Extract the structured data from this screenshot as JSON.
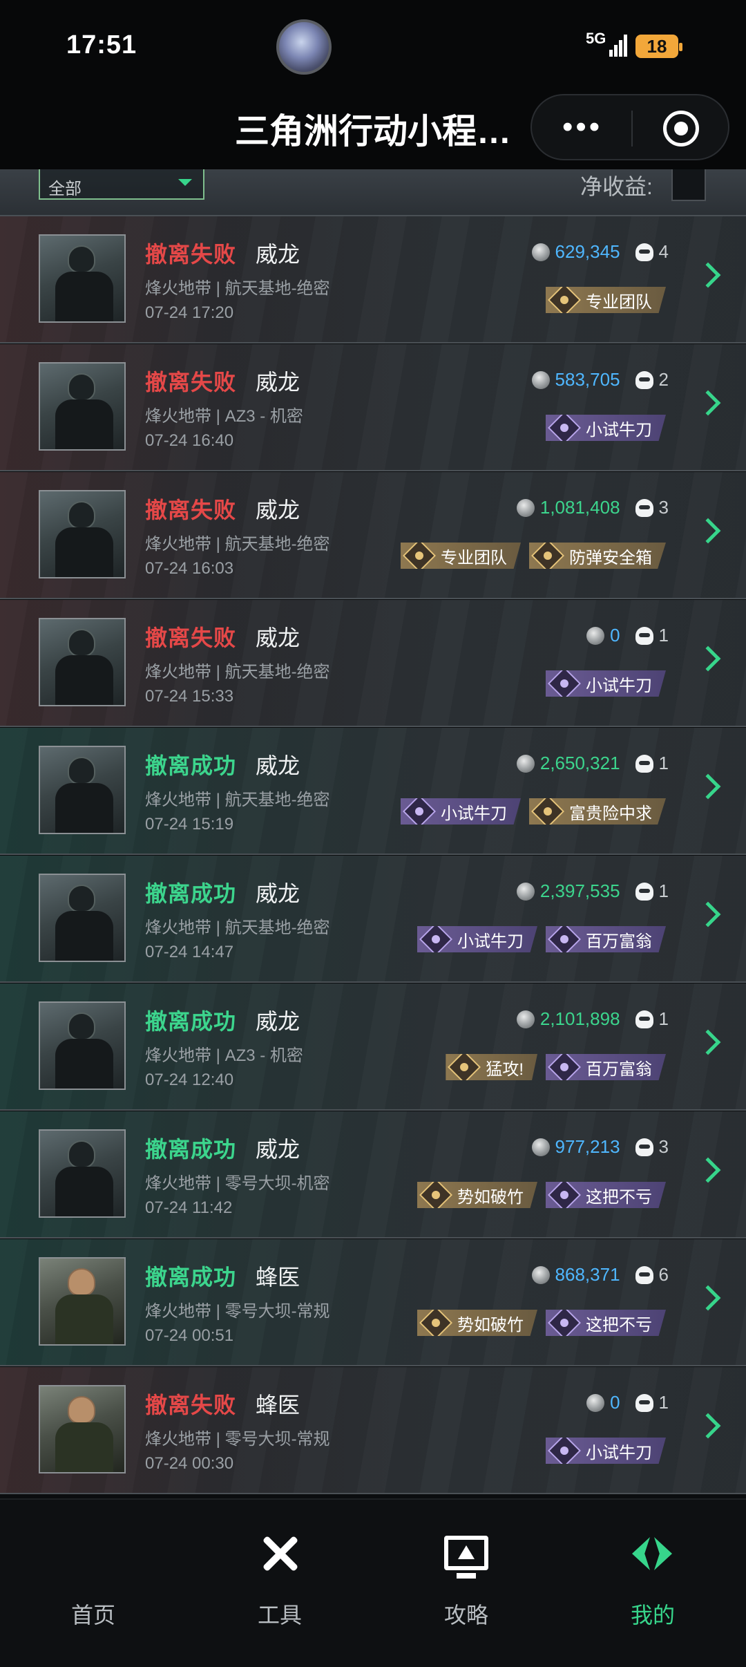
{
  "status_bar": {
    "time": "17:51",
    "network": "5G",
    "battery": "18"
  },
  "title_bar": {
    "title": "三角洲行动小程…",
    "more_glyph": "•••"
  },
  "filter": {
    "selected": "全部",
    "net_income_label": "净收益:"
  },
  "colors": {
    "fail": "#e54848",
    "success": "#3cd58d",
    "accent": "#37d58b",
    "value_blue": "#4fb7ff"
  },
  "rows": [
    {
      "status": "撤离失败",
      "result": "fail",
      "operator": "威龙",
      "avatar": "soldier",
      "map": "烽火地带 | 航天基地-绝密",
      "datetime": "07-24 17:20",
      "value": "629,345",
      "value_color": "blue",
      "kills": "4",
      "badges": [
        {
          "label": "专业团队",
          "tier": "gold"
        }
      ]
    },
    {
      "status": "撤离失败",
      "result": "fail",
      "operator": "威龙",
      "avatar": "soldier",
      "map": "烽火地带 | AZ3 - 机密",
      "datetime": "07-24 16:40",
      "value": "583,705",
      "value_color": "blue",
      "kills": "2",
      "badges": [
        {
          "label": "小试牛刀",
          "tier": "purple"
        }
      ]
    },
    {
      "status": "撤离失败",
      "result": "fail",
      "operator": "威龙",
      "avatar": "soldier",
      "map": "烽火地带 | 航天基地-绝密",
      "datetime": "07-24 16:03",
      "value": "1,081,408",
      "value_color": "green",
      "kills": "3",
      "badges": [
        {
          "label": "专业团队",
          "tier": "gold"
        },
        {
          "label": "防弹安全箱",
          "tier": "gold"
        }
      ]
    },
    {
      "status": "撤离失败",
      "result": "fail",
      "operator": "威龙",
      "avatar": "soldier",
      "map": "烽火地带 | 航天基地-绝密",
      "datetime": "07-24 15:33",
      "value": "0",
      "value_color": "blue",
      "kills": "1",
      "badges": [
        {
          "label": "小试牛刀",
          "tier": "purple"
        }
      ]
    },
    {
      "status": "撤离成功",
      "result": "success",
      "operator": "威龙",
      "avatar": "soldier",
      "map": "烽火地带 | 航天基地-绝密",
      "datetime": "07-24 15:19",
      "value": "2,650,321",
      "value_color": "green",
      "kills": "1",
      "badges": [
        {
          "label": "小试牛刀",
          "tier": "purple"
        },
        {
          "label": "富贵险中求",
          "tier": "gold"
        }
      ]
    },
    {
      "status": "撤离成功",
      "result": "success",
      "operator": "威龙",
      "avatar": "soldier",
      "map": "烽火地带 | 航天基地-绝密",
      "datetime": "07-24 14:47",
      "value": "2,397,535",
      "value_color": "green",
      "kills": "1",
      "badges": [
        {
          "label": "小试牛刀",
          "tier": "purple"
        },
        {
          "label": "百万富翁",
          "tier": "purple"
        }
      ]
    },
    {
      "status": "撤离成功",
      "result": "success",
      "operator": "威龙",
      "avatar": "soldier",
      "map": "烽火地带 | AZ3 - 机密",
      "datetime": "07-24 12:40",
      "value": "2,101,898",
      "value_color": "green",
      "kills": "1",
      "badges": [
        {
          "label": "猛攻!",
          "tier": "gold"
        },
        {
          "label": "百万富翁",
          "tier": "purple"
        }
      ]
    },
    {
      "status": "撤离成功",
      "result": "success",
      "operator": "威龙",
      "avatar": "soldier",
      "map": "烽火地带 | 零号大坝-机密",
      "datetime": "07-24 11:42",
      "value": "977,213",
      "value_color": "blue",
      "kills": "3",
      "badges": [
        {
          "label": "势如破竹",
          "tier": "gold"
        },
        {
          "label": "这把不亏",
          "tier": "purple"
        }
      ]
    },
    {
      "status": "撤离成功",
      "result": "success",
      "operator": "蜂医",
      "avatar": "medic",
      "map": "烽火地带 | 零号大坝-常规",
      "datetime": "07-24 00:51",
      "value": "868,371",
      "value_color": "blue",
      "kills": "6",
      "badges": [
        {
          "label": "势如破竹",
          "tier": "gold"
        },
        {
          "label": "这把不亏",
          "tier": "purple"
        }
      ]
    },
    {
      "status": "撤离失败",
      "result": "fail",
      "operator": "蜂医",
      "avatar": "medic",
      "map": "烽火地带 | 零号大坝-常规",
      "datetime": "07-24 00:30",
      "value": "0",
      "value_color": "blue",
      "kills": "1",
      "badges": [
        {
          "label": "小试牛刀",
          "tier": "purple"
        }
      ]
    }
  ],
  "nav": [
    {
      "label": "首页",
      "icon": "home-icon",
      "active": false
    },
    {
      "label": "工具",
      "icon": "tools-icon",
      "active": false
    },
    {
      "label": "攻略",
      "icon": "guide-icon",
      "active": false
    },
    {
      "label": "我的",
      "icon": "mine-icon",
      "active": true
    }
  ]
}
